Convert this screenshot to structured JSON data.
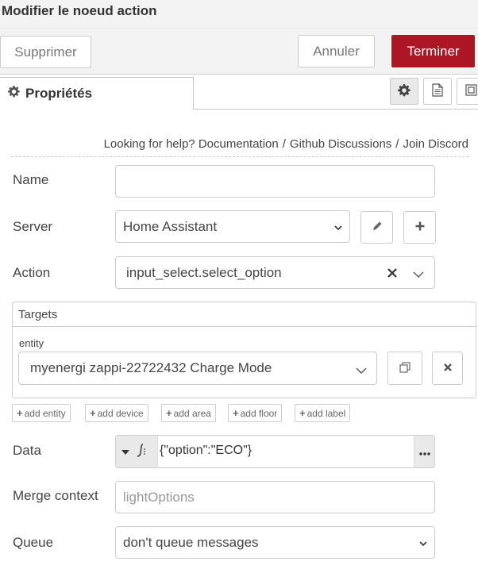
{
  "header": {
    "title": "Modifier le noeud action"
  },
  "toolbar": {
    "delete_label": "Supprimer",
    "cancel_label": "Annuler",
    "done_label": "Terminer"
  },
  "tabs": {
    "properties_label": "Propriétés"
  },
  "help": {
    "prefix": "Looking for help?",
    "links": [
      "Documentation",
      "Github Discussions",
      "Join Discord"
    ],
    "separator": "/"
  },
  "form": {
    "name": {
      "label": "Name",
      "value": ""
    },
    "server": {
      "label": "Server",
      "value": "Home Assistant"
    },
    "action": {
      "label": "Action",
      "value": "input_select.select_option"
    },
    "targets": {
      "title": "Targets",
      "entity_label": "entity",
      "entity_value": "myenergi zappi-22722432 Charge Mode",
      "add_buttons": [
        "add entity",
        "add device",
        "add area",
        "add floor",
        "add label"
      ]
    },
    "data": {
      "label": "Data",
      "value": "{\"option\":\"ECO\"}"
    },
    "merge_context": {
      "label": "Merge context",
      "placeholder": "lightOptions"
    },
    "queue": {
      "label": "Queue",
      "value": "don't queue messages"
    }
  },
  "colors": {
    "primary": "#ad1625",
    "toolbar_bg": "#f3f3f3",
    "border": "#cccccc"
  },
  "icons": {
    "tab_properties": "gear-icon",
    "tab_settings": "gear-icon",
    "tab_description": "document-icon",
    "tab_appearance": "frame-icon",
    "server_edit": "pencil-icon",
    "server_add": "plus-icon",
    "action_clear": "close-icon",
    "dropdown": "chevron-down-icon",
    "entity_copy": "copy-icon",
    "entity_remove": "close-icon",
    "data_type": "jsonata-icon",
    "data_more": "ellipsis-icon"
  }
}
